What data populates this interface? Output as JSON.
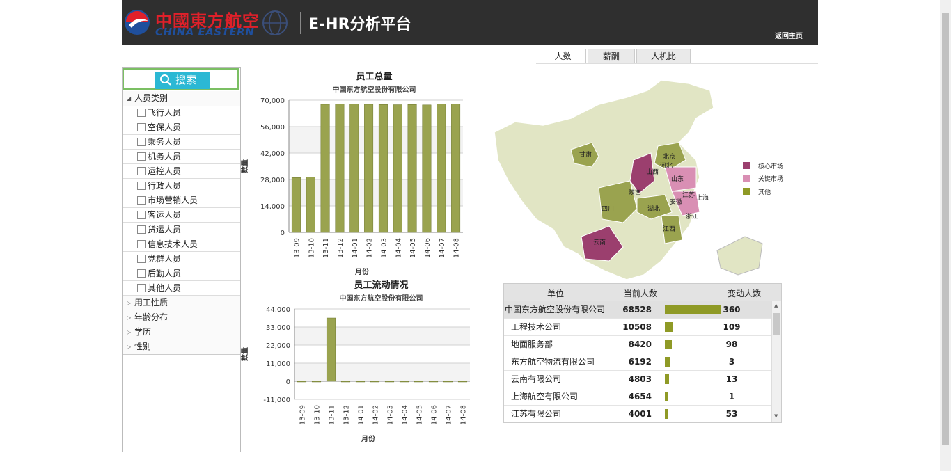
{
  "header": {
    "logo_cn": "中國東方航空",
    "logo_en": "CHINA EASTERN",
    "title": "E-HR分析平台",
    "back_home": "返回主页"
  },
  "tabs": [
    {
      "label": "人数",
      "active": true
    },
    {
      "label": "薪酬",
      "active": false
    },
    {
      "label": "人机比",
      "active": false
    }
  ],
  "sidebar": {
    "search_label": "搜索",
    "groups": [
      {
        "label": "人员类别",
        "expanded": true,
        "items": [
          "飞行人员",
          "空保人员",
          "乘务人员",
          "机务人员",
          "运控人员",
          "行政人员",
          "市场营销人员",
          "客运人员",
          "货运人员",
          "信息技术人员",
          "党群人员",
          "后勤人员",
          "其他人员"
        ]
      },
      {
        "label": "用工性质",
        "expanded": false
      },
      {
        "label": "年龄分布",
        "expanded": false
      },
      {
        "label": "学历",
        "expanded": false
      },
      {
        "label": "性别",
        "expanded": false
      }
    ]
  },
  "chart_data": [
    {
      "type": "bar",
      "title": "员工总量",
      "subtitle": "中国东方航空股份有限公司",
      "xlabel": "月份",
      "ylabel": "数量",
      "ylim": [
        0,
        70000
      ],
      "yticks": [
        "70,000",
        "56,000",
        "42,000",
        "28,000",
        "14,000",
        "0"
      ],
      "categories": [
        "13-09",
        "13-10",
        "13-11",
        "13-12",
        "14-01",
        "14-02",
        "14-03",
        "14-04",
        "14-05",
        "14-06",
        "14-07",
        "14-08"
      ],
      "values": [
        29000,
        29200,
        67800,
        68000,
        67900,
        67800,
        67700,
        67600,
        67700,
        67500,
        67900,
        68000
      ],
      "color": "#9aa34f"
    },
    {
      "type": "bar",
      "title": "员工流动情况",
      "subtitle": "中国东方航空股份有限公司",
      "xlabel": "月份",
      "ylabel": "数量",
      "ylim": [
        -11000,
        44000
      ],
      "yticks": [
        "44,000",
        "33,000",
        "22,000",
        "11,000",
        "0",
        "-11,000"
      ],
      "categories": [
        "13-09",
        "13-10",
        "13-11",
        "13-12",
        "14-01",
        "14-02",
        "14-03",
        "14-04",
        "14-05",
        "14-06",
        "14-07",
        "14-08"
      ],
      "values": [
        -200,
        -300,
        38500,
        -200,
        -100,
        -200,
        -150,
        -200,
        -250,
        -200,
        -100,
        -150
      ],
      "color": "#9aa34f"
    }
  ],
  "map": {
    "legend": [
      {
        "label": "核心市场",
        "color": "#9b3f6e"
      },
      {
        "label": "关键市场",
        "color": "#d98fb4"
      },
      {
        "label": "其他",
        "color": "#8f9a26"
      }
    ],
    "provinces": [
      "甘肃",
      "北京",
      "河北",
      "山西",
      "山东",
      "陕西",
      "江苏",
      "上海",
      "四川",
      "湖北",
      "安徽",
      "浙江",
      "江西",
      "云南"
    ]
  },
  "table": {
    "headers": [
      "单位",
      "当前人数",
      "变动人数"
    ],
    "max": 68528,
    "rows": [
      {
        "name": "中国东方航空股份有限公司",
        "current": 68528,
        "change": "360"
      },
      {
        "name": "工程技术公司",
        "current": 10508,
        "change": "109"
      },
      {
        "name": "地面服务部",
        "current": 8420,
        "change": "98"
      },
      {
        "name": "东方航空物流有限公司",
        "current": 6192,
        "change": "3"
      },
      {
        "name": "云南有限公司",
        "current": 4803,
        "change": "13"
      },
      {
        "name": "上海航空有限公司",
        "current": 4654,
        "change": "1"
      },
      {
        "name": "江苏有限公司",
        "current": 4001,
        "change": "53"
      }
    ]
  }
}
